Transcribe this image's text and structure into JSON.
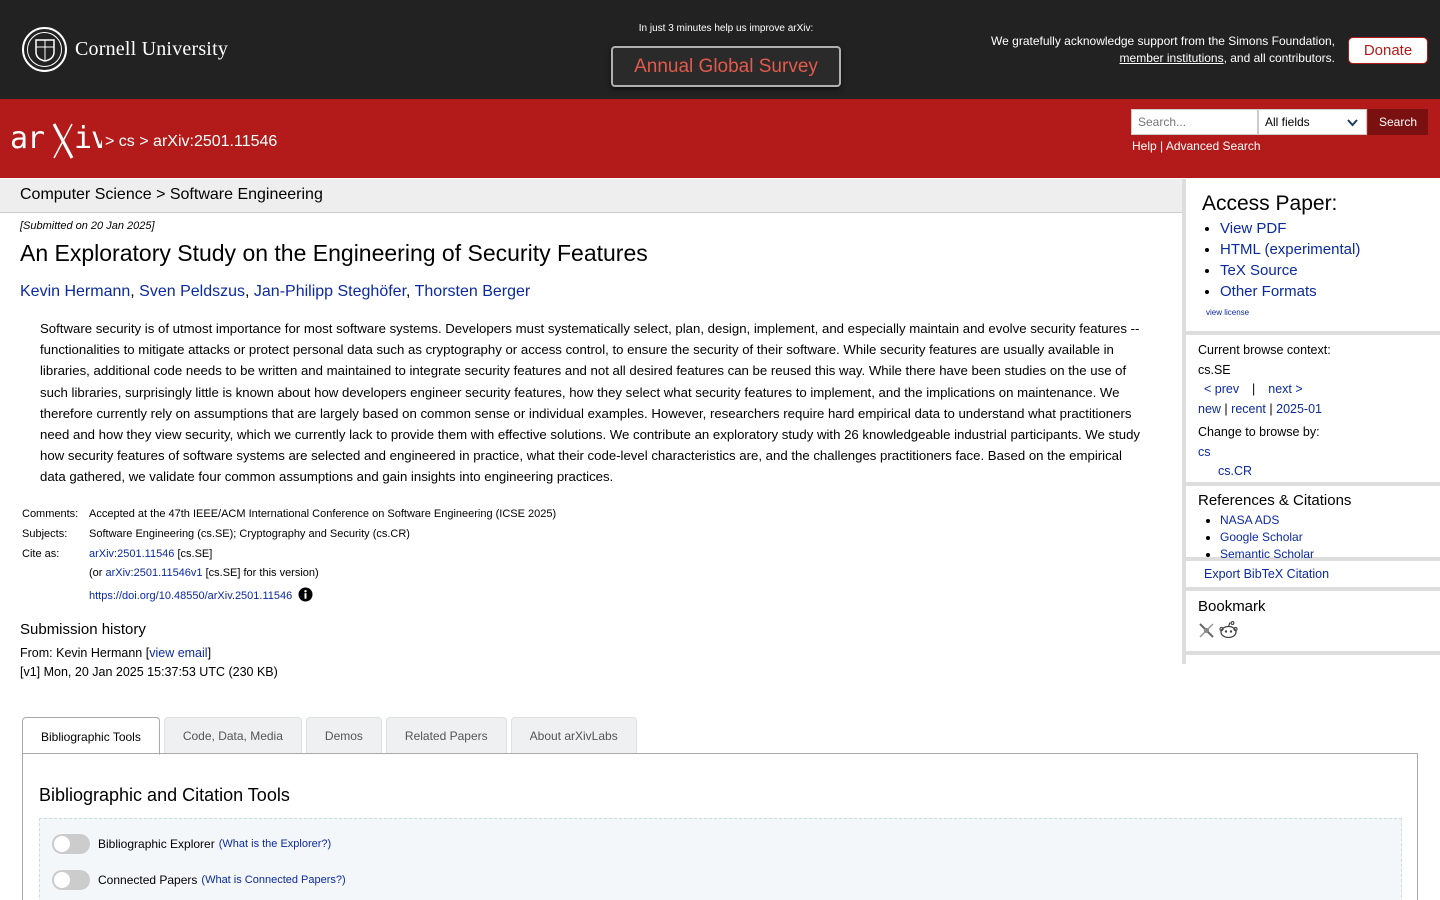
{
  "banner": {
    "university": "Cornell University",
    "survey_hint": "In just 3 minutes help us improve arXiv:",
    "survey_button": "Annual Global Survey",
    "support_line1": "We gratefully acknowledge support from the Simons Foundation,",
    "support_link": "member institutions",
    "support_line2_rest": ", and all contributors.",
    "donate": "Donate"
  },
  "header": {
    "sep1": ">",
    "crumb_cs": "cs",
    "sep2": ">",
    "crumb_id": "arXiv:2501.11546",
    "search_placeholder": "Search...",
    "field_selected": "All fields",
    "search_button": "Search",
    "help": "Help",
    "pipe": "|",
    "advanced": "Advanced Search"
  },
  "category_bar": "Computer Science > Software Engineering",
  "paper": {
    "dateline": "[Submitted on 20 Jan 2025]",
    "title": "An Exploratory Study on the Engineering of Security Features",
    "authors": [
      "Kevin Hermann",
      "Sven Peldszus",
      "Jan-Philipp Steghöfer",
      "Thorsten Berger"
    ],
    "author_sep": ", ",
    "abstract": "Software security is of utmost importance for most software systems. Developers must systematically select, plan, design, implement, and especially maintain and evolve security features -- functionalities to mitigate attacks or protect personal data such as cryptography or access control, to ensure the security of their software. While security features are usually available in libraries, additional code needs to be written and maintained to integrate security features and not all desired features can be reused this way. While there have been studies on the use of such libraries, surprisingly little is known about how developers engineer security features, how they select what security features to implement, and the implications on maintenance. We therefore currently rely on assumptions that are largely based on common sense or individual examples. However, researchers require hard empirical data to understand what practitioners need and how they view security, which we currently lack to provide them with effective solutions. We contribute an exploratory study with 26 knowledgeable industrial participants. We study how security features of software systems are selected and engineered in practice, what their code-level characteristics are, and the challenges practitioners face. Based on the empirical data gathered, we validate four common assumptions and gain insights into engineering practices.",
    "comments_label": "Comments:",
    "comments": "Accepted at the 47th IEEE/ACM International Conference on Software Engineering (ICSE 2025)",
    "subjects_label": "Subjects:",
    "subjects": "Software Engineering (cs.SE); Cryptography and Security (cs.CR)",
    "cite_label": "Cite as:",
    "cite_id": "arXiv:2501.11546",
    "cite_tag": " [cs.SE]",
    "cite_or": "(or ",
    "cite_version_id": "arXiv:2501.11546v1",
    "cite_version_rest": " [cs.SE] for this version)",
    "doi": "https://doi.org/10.48550/arXiv.2501.11546",
    "history_title": "Submission history",
    "from_prefix": "From: Kevin Hermann [",
    "view_email": "view email",
    "from_suffix": "]",
    "v1": "[v1] Mon, 20 Jan 2025 15:37:53 UTC (230 KB)"
  },
  "sidebar": {
    "access_title": "Access Paper:",
    "access_links": [
      "View PDF",
      "HTML (experimental)",
      "TeX Source",
      "Other Formats"
    ],
    "view_license": "view license",
    "browse_context_label": "Current browse context:",
    "browse_context": "cs.SE",
    "prev": "< prev",
    "nav_pipe": "|",
    "next": "next >",
    "new": "new",
    "recent": "recent",
    "month": "2025-01",
    "change_label": "Change to browse by:",
    "change_cs": "cs",
    "change_cscr": "cs.CR",
    "refs_title": "References & Citations",
    "refs_links": [
      "NASA ADS",
      "Google Scholar",
      "Semantic Scholar"
    ],
    "bibtex": "Export BibTeX Citation",
    "bookmark_title": "Bookmark"
  },
  "tabs": {
    "items": [
      "Bibliographic Tools",
      "Code, Data, Media",
      "Demos",
      "Related Papers",
      "About arXivLabs"
    ],
    "panel_title": "Bibliographic and Citation Tools",
    "tool1": "Bibliographic Explorer",
    "tool1_link": "(What is the Explorer?)",
    "tool2": "Connected Papers",
    "tool2_link": "(What is Connected Papers?)"
  },
  "colors": {
    "arxiv_red": "#b31b1b",
    "banner_dark": "#222222",
    "link_blue": "#0b2aa0",
    "survey_text": "#e25a4c"
  }
}
